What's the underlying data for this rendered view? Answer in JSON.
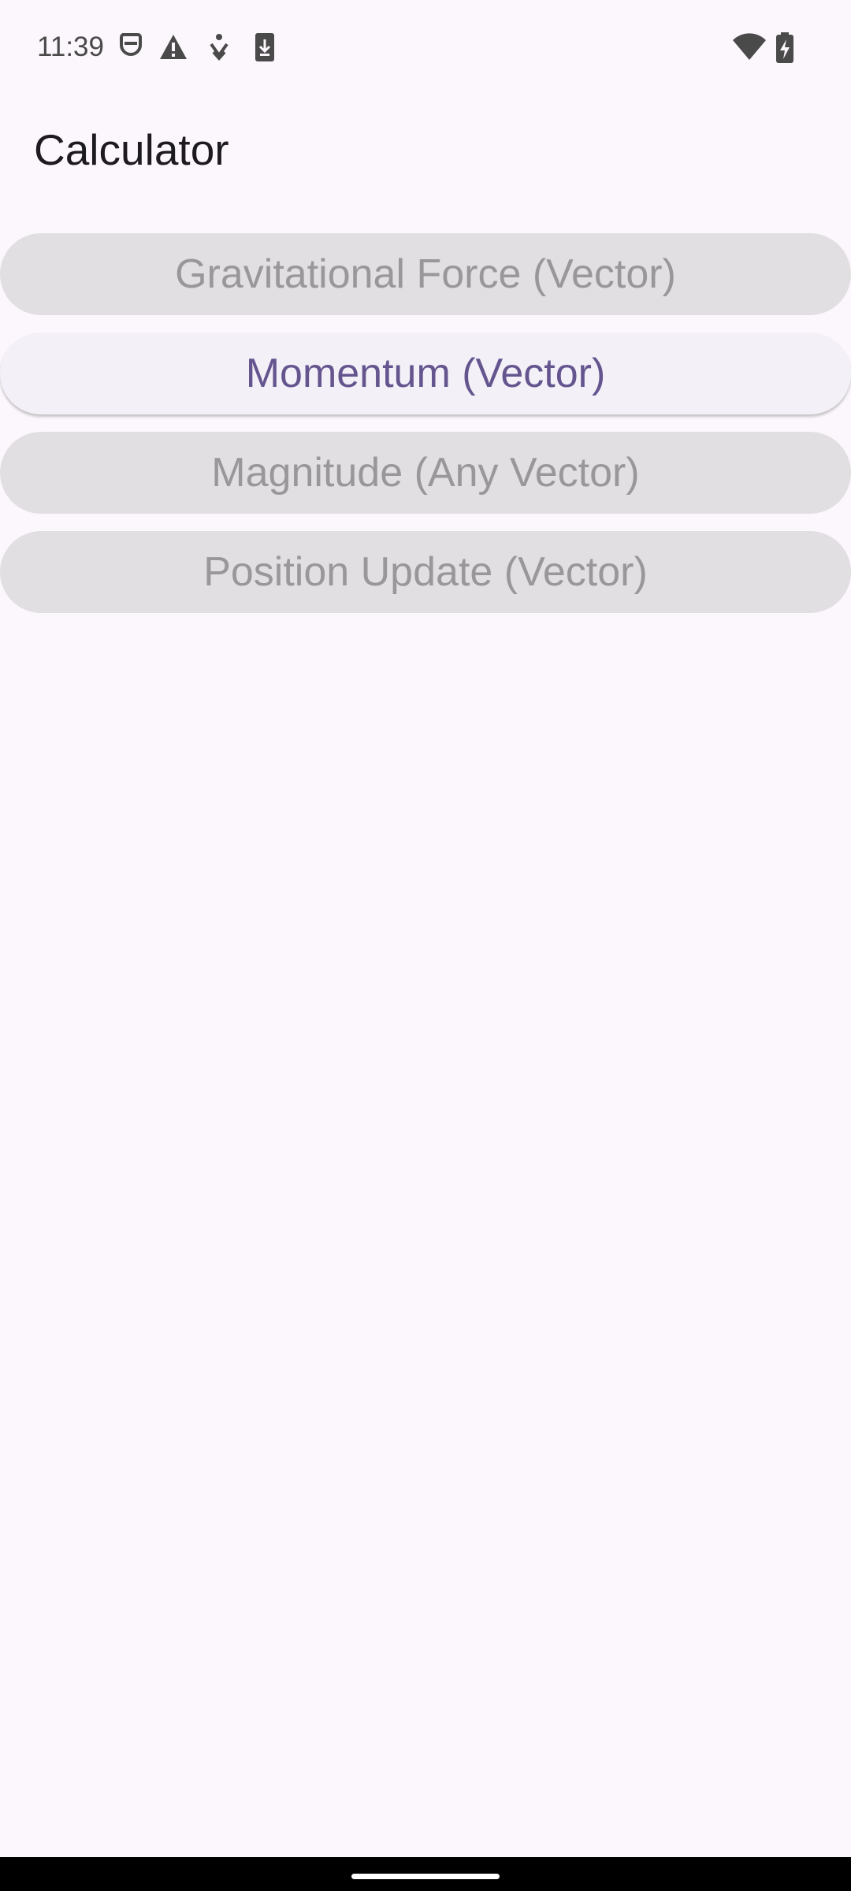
{
  "status_bar": {
    "time": "11:39",
    "left_icons": [
      "sim-card-icon",
      "warning-icon",
      "accessibility-icon",
      "download-icon"
    ],
    "right_icons": [
      "wifi-icon",
      "battery-charging-icon"
    ],
    "icon_color": "#4a4a4a"
  },
  "app": {
    "title": "Calculator"
  },
  "buttons": [
    {
      "label": "Gravitational Force (Vector)",
      "state": "disabled"
    },
    {
      "label": "Momentum (Vector)",
      "state": "selected"
    },
    {
      "label": "Magnitude (Any Vector)",
      "state": "disabled"
    },
    {
      "label": "Position Update (Vector)",
      "state": "disabled"
    }
  ],
  "colors": {
    "background": "#fcf7fc",
    "button_disabled_bg": "#e2dfe3",
    "button_disabled_text": "#9a979b",
    "button_selected_bg": "#f3f0f7",
    "button_selected_text": "#65558f"
  }
}
